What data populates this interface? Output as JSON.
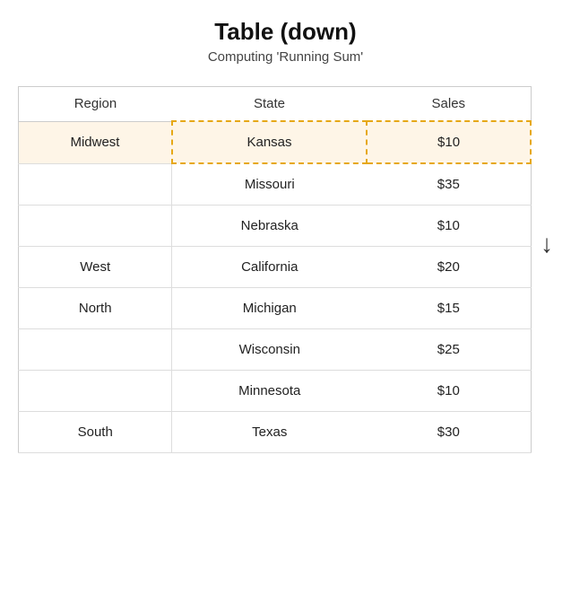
{
  "title": "Table (down)",
  "subtitle": "Computing 'Running Sum'",
  "columns": [
    "Region",
    "State",
    "Sales"
  ],
  "rows": [
    {
      "region": "Midwest",
      "state": "Kansas",
      "sales": "$10",
      "highlighted": true,
      "regionStart": true,
      "showRegion": true
    },
    {
      "region": "",
      "state": "Missouri",
      "sales": "$35",
      "highlighted": false,
      "regionStart": false,
      "showRegion": false
    },
    {
      "region": "",
      "state": "Nebraska",
      "sales": "$10",
      "highlighted": false,
      "regionStart": false,
      "showRegion": false
    },
    {
      "region": "West",
      "state": "California",
      "sales": "$20",
      "highlighted": false,
      "regionStart": true,
      "showRegion": true
    },
    {
      "region": "North",
      "state": "Michigan",
      "sales": "$15",
      "highlighted": false,
      "regionStart": true,
      "showRegion": true
    },
    {
      "region": "",
      "state": "Wisconsin",
      "sales": "$25",
      "highlighted": false,
      "regionStart": false,
      "showRegion": false
    },
    {
      "region": "",
      "state": "Minnesota",
      "sales": "$10",
      "highlighted": false,
      "regionStart": false,
      "showRegion": false
    },
    {
      "region": "South",
      "state": "Texas",
      "sales": "$30",
      "highlighted": false,
      "regionStart": true,
      "showRegion": true
    }
  ],
  "arrow": "↓"
}
